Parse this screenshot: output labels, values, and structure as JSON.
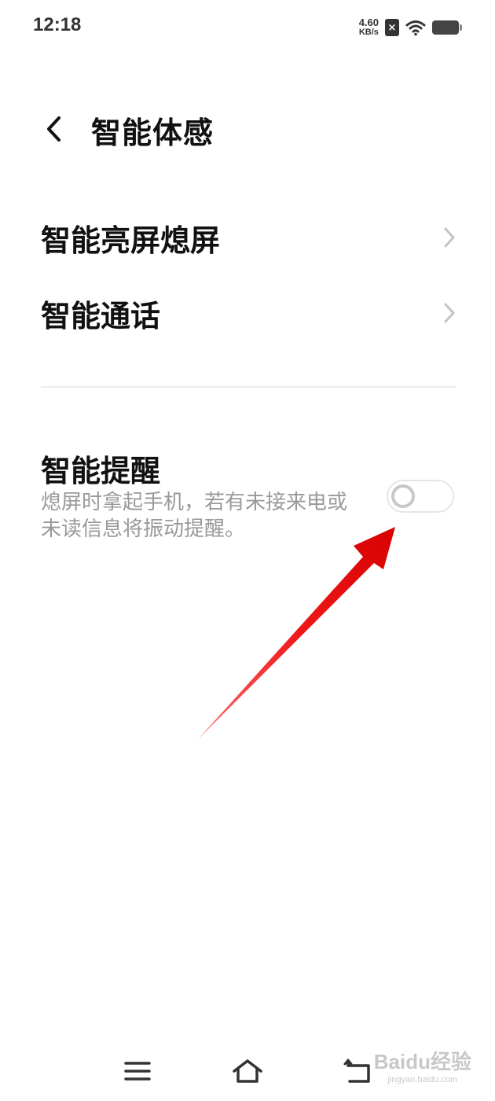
{
  "status_bar": {
    "time": "12:18",
    "net_speed_value": "4.60",
    "net_speed_unit": "KB/s",
    "sim_icon": "sim-no-service-icon",
    "wifi_icon": "wifi-icon",
    "battery_icon": "battery-icon"
  },
  "header": {
    "back_icon": "chevron-left-icon",
    "title": "智能体感"
  },
  "menu": [
    {
      "label": "智能亮屏熄屏",
      "icon": "chevron-right-icon"
    },
    {
      "label": "智能通话",
      "icon": "chevron-right-icon"
    }
  ],
  "smart_reminder": {
    "title": "智能提醒",
    "description": "熄屏时拿起手机，若有未接来电或未读信息将振动提醒。",
    "toggle_on": false
  },
  "annotation": {
    "color": "#e8101a"
  },
  "bottom_nav": {
    "menu_icon": "menu-icon",
    "home_icon": "home-icon",
    "back_icon": "back-icon"
  },
  "watermark": {
    "logo": "Baidu经验",
    "url": "jingyan.baidu.com"
  }
}
